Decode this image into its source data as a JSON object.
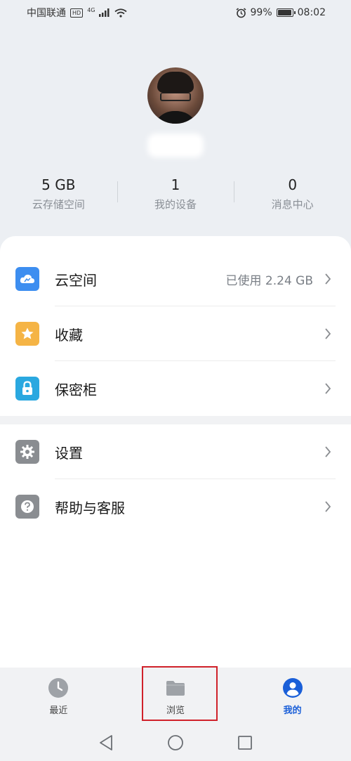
{
  "status_bar": {
    "carrier": "中国联通",
    "hd": "HD",
    "network": "4G",
    "battery_percent": "99%",
    "battery_level": 0.99,
    "time": "08:02"
  },
  "profile": {
    "avatar_icon": "user-avatar-photo"
  },
  "stats": [
    {
      "value": "5 GB",
      "label": "云存储空间"
    },
    {
      "value": "1",
      "label": "我的设备"
    },
    {
      "value": "0",
      "label": "消息中心"
    }
  ],
  "menu": {
    "cloud_space": {
      "label": "云空间",
      "value": "已使用 2.24 GB",
      "icon": "cloud-icon",
      "color": "#3d8ef0"
    },
    "favorites": {
      "label": "收藏",
      "icon": "star-icon",
      "color": "#f5b445"
    },
    "safe_box": {
      "label": "保密柜",
      "icon": "lock-icon",
      "color": "#2aa8e0"
    },
    "settings": {
      "label": "设置",
      "icon": "gear-icon",
      "color": "#8a8d91"
    },
    "help": {
      "label": "帮助与客服",
      "icon": "question-icon",
      "color": "#8a8d91"
    }
  },
  "bottom_nav": [
    {
      "label": "最近",
      "icon": "clock-icon"
    },
    {
      "label": "浏览",
      "icon": "folder-icon"
    },
    {
      "label": "我的",
      "icon": "person-icon",
      "active": true
    }
  ],
  "system_nav": {
    "back": "back-icon",
    "home": "home-icon",
    "recents": "recents-icon"
  },
  "colors": {
    "accent": "#1a5fd8",
    "highlight": "#d0212a"
  }
}
